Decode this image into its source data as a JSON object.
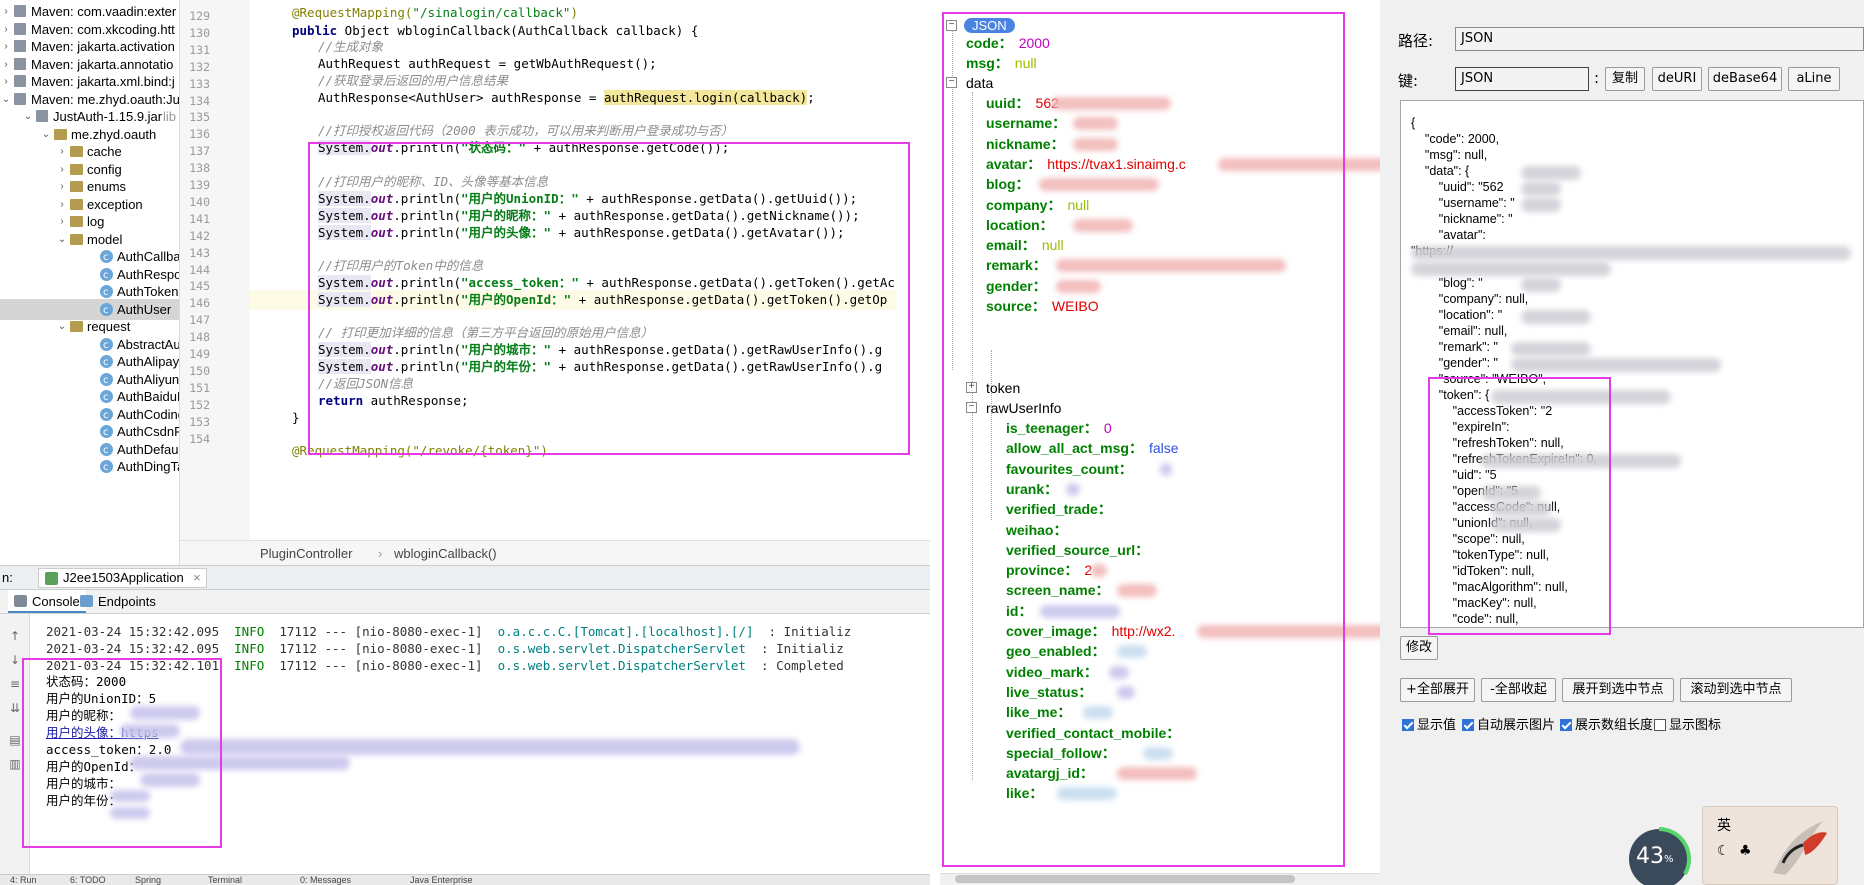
{
  "tree": {
    "rows": [
      {
        "label": "Maven: com.vaadin:exter",
        "type": "lib",
        "indent": 0
      },
      {
        "label": "Maven: com.xkcoding.htt",
        "type": "lib",
        "indent": 0
      },
      {
        "label": "Maven: jakarta.activation",
        "type": "lib",
        "indent": 0
      },
      {
        "label": "Maven: jakarta.annotatio",
        "type": "lib",
        "indent": 0
      },
      {
        "label": "Maven: jakarta.xml.bind:j",
        "type": "lib",
        "indent": 0
      },
      {
        "label": "Maven: me.zhyd.oauth:Ju",
        "type": "lib",
        "indent": 0
      },
      {
        "label": "JustAuth-1.15.9.jar",
        "suffix": "lib",
        "type": "lib",
        "indent": 1
      },
      {
        "label": "me.zhyd.oauth",
        "type": "pkg",
        "indent": 2
      },
      {
        "label": "cache",
        "type": "pkg",
        "indent": 3
      },
      {
        "label": "config",
        "type": "pkg",
        "indent": 3
      },
      {
        "label": "enums",
        "type": "pkg",
        "indent": 3
      },
      {
        "label": "exception",
        "type": "pkg",
        "indent": 3
      },
      {
        "label": "log",
        "type": "pkg",
        "indent": 3
      },
      {
        "label": "model",
        "type": "pkg",
        "indent": 3
      },
      {
        "label": "AuthCallba",
        "type": "cls",
        "indent": 4
      },
      {
        "label": "AuthRespo",
        "type": "cls",
        "indent": 4
      },
      {
        "label": "AuthToken",
        "type": "cls",
        "indent": 4
      },
      {
        "label": "AuthUser",
        "type": "cls",
        "indent": 4
      },
      {
        "label": "request",
        "type": "pkg",
        "indent": 3
      },
      {
        "label": "AbstractAu",
        "type": "cls",
        "indent": 4
      },
      {
        "label": "AuthAlipayl",
        "type": "cls",
        "indent": 4
      },
      {
        "label": "AuthAliyunl",
        "type": "cls",
        "indent": 4
      },
      {
        "label": "AuthBaiduF",
        "type": "cls",
        "indent": 4
      },
      {
        "label": "AuthCodingl",
        "type": "cls",
        "indent": 4
      },
      {
        "label": "AuthCsdnR",
        "type": "cls",
        "indent": 4
      },
      {
        "label": "AuthDefaul",
        "type": "cls",
        "indent": 4
      },
      {
        "label": "AuthDingTa",
        "type": "cls",
        "indent": 4
      }
    ]
  },
  "editor": {
    "line_numbers": [
      "129",
      "130",
      "131",
      "132",
      "133",
      "134",
      "135",
      "136",
      "137",
      "138",
      "139",
      "140",
      "141",
      "142",
      "143",
      "144",
      "145",
      "146",
      "147",
      "148",
      "149",
      "150",
      "151",
      "152",
      "153",
      "154"
    ],
    "annotation_top": "@RequestMapping(",
    "annotation_top_arg": "\"/sinalogin/callback\"",
    "annotation_top_end": ")",
    "sig_public": "public",
    "sig_rest": " Object wbloginCallback(AuthCallback callback) {",
    "c1": "//生成对象",
    "l1": "AuthRequest authRequest = getWbAuthRequest();",
    "c2": "//获取登录后返回的用户信息结果",
    "l2a": "AuthResponse<AuthUser> authResponse = ",
    "l2b": "authRequest.login(callback)",
    "l2c": ";",
    "c3a": "//打印授权返回代码（",
    "c3b": "2000",
    "c3c": " 表示成功，可以用来判断用户登录成功与否）",
    "p1s": "\"状态码：\"",
    "p1r": " + authResponse.getCode());",
    "c4a": "//打印用户的昵称、",
    "c4b": "ID",
    "c4c": "、头像等基本信息",
    "p2s": "\"用户的UnionID：\"",
    "p2r": " + authResponse.getData().getUuid());",
    "p3s": "\"用户的昵称：\"",
    "p3r": " + authResponse.getData().getNickname());",
    "p4s": "\"用户的头像：\"",
    "p4r": " + authResponse.getData().getAvatar());",
    "c5a": "//打印用户的",
    "c5b": "Token",
    "c5c": "中的信息",
    "p5s": "\"access_token：\"",
    "p5r": " + authResponse.getData().getToken().getAc",
    "p6s": "\"用户的OpenId：\"",
    "p6r": " + authResponse.getData().getToken().getOp",
    "c6": "// 打印更加详细的信息（第三方平台返回的原始用户信息）",
    "p7s": "\"用户的城市：\"",
    "p7r": " + authResponse.getData().getRawUserInfo().g",
    "p8s": "\"用户的年份：\"",
    "p8r": " + authResponse.getData().getRawUserInfo().g",
    "c7a": "//返回",
    "c7b": "JSON",
    "c7c": "信息",
    "ret_kw": "return",
    "ret_rest": " authResponse;",
    "close_brace": "}",
    "annotation_bottom": "@RequestMapping(\"/revoke/{token}\")",
    "sys": "System.",
    "out": "out",
    "println": ".println("
  },
  "breadcrumb": {
    "item1": "PluginController",
    "sep": "›",
    "item2": "wbloginCallback()"
  },
  "run_bar": {
    "prefix": "n:",
    "tab": "J2ee1503Application",
    "close": "×"
  },
  "console_tabs": {
    "console": "Console",
    "endpoints": "Endpoints"
  },
  "console": {
    "logs": [
      {
        "ts": "2021-03-24 15:32:42.095",
        "lvl": "INFO",
        "pid": "17112 --- [nio-8080-exec-1]",
        "cat": "o.a.c.c.C.[Tomcat].[localhost].[/]",
        "msg": ": Initializ"
      },
      {
        "ts": "2021-03-24 15:32:42.095",
        "lvl": "INFO",
        "pid": "17112 --- [nio-8080-exec-1]",
        "cat": "o.s.web.servlet.DispatcherServlet",
        "msg": ": Initializ"
      },
      {
        "ts": "2021-03-24 15:32:42.101",
        "lvl": "INFO",
        "pid": "17112 --- [nio-8080-exec-1]",
        "cat": "o.s.web.servlet.DispatcherServlet",
        "msg": ": Completed"
      }
    ],
    "out": [
      "状态码：2000",
      "用户的UnionID：5",
      "用户的昵称：",
      "用户的头像：https",
      "access_token：2.0",
      "用户的OpenId：",
      "用户的城市：",
      "用户的年份："
    ]
  },
  "status_bar": {
    "run": "4: Run",
    "todo": "6: TODO",
    "spring": "Spring",
    "terminal": "Terminal",
    "messages": "0: Messages",
    "java": "Java Enterprise"
  },
  "json_tree": {
    "root": "JSON",
    "code_key": "code：",
    "code_val": "2000",
    "msg_key": "msg：",
    "msg_val": "null",
    "data_key": "data",
    "data_fields": [
      {
        "key": "uuid：",
        "val": "562",
        "kind": "str"
      },
      {
        "key": "username：",
        "val": "",
        "kind": "str"
      },
      {
        "key": "nickname：",
        "val": "",
        "kind": "str"
      },
      {
        "key": "avatar：",
        "val": "https://tvax1.sinaimg.c",
        "kind": "str"
      },
      {
        "key": "blog：",
        "val": "",
        "kind": "str"
      },
      {
        "key": "company：",
        "val": "null",
        "kind": "null"
      },
      {
        "key": "location：",
        "val": "",
        "kind": "str"
      },
      {
        "key": "email：",
        "val": "null",
        "kind": "null"
      },
      {
        "key": "remark：",
        "val": "",
        "kind": "str"
      },
      {
        "key": "gender：",
        "val": "",
        "kind": "str"
      },
      {
        "key": "source：",
        "val": "WEIBO",
        "kind": "str"
      }
    ],
    "token_key": "token",
    "raw_key": "rawUserInfo",
    "raw_fields": [
      {
        "key": "is_teenager：",
        "val": "0",
        "kind": "num"
      },
      {
        "key": "allow_all_act_msg：",
        "val": "false",
        "kind": "bool"
      },
      {
        "key": "favourites_count：",
        "val": "",
        "kind": "num"
      },
      {
        "key": "urank：",
        "val": "",
        "kind": "num"
      },
      {
        "key": "verified_trade：",
        "val": "",
        "kind": "str"
      },
      {
        "key": "weihao：",
        "val": "",
        "kind": "str"
      },
      {
        "key": "verified_source_url：",
        "val": "",
        "kind": "str"
      },
      {
        "key": "province：",
        "val": "2",
        "kind": "str"
      },
      {
        "key": "screen_name：",
        "val": "",
        "kind": "str"
      },
      {
        "key": "id：",
        "val": "",
        "kind": "num"
      },
      {
        "key": "cover_image：",
        "val": "http://wx2.",
        "kind": "str"
      },
      {
        "key": "geo_enabled：",
        "val": "",
        "kind": "bool"
      },
      {
        "key": "video_mark：",
        "val": "",
        "kind": "num"
      },
      {
        "key": "live_status：",
        "val": "",
        "kind": "num"
      },
      {
        "key": "like_me：",
        "val": "",
        "kind": "bool"
      },
      {
        "key": "verified_contact_mobile：",
        "val": "",
        "kind": "str"
      },
      {
        "key": "special_follow：",
        "val": "",
        "kind": "bool"
      },
      {
        "key": "avatargj_id：",
        "val": "",
        "kind": "str"
      },
      {
        "key": "like：",
        "val": "",
        "kind": "bool"
      }
    ]
  },
  "panel": {
    "path_label": "路径:",
    "path_value": "JSON",
    "key_label": "键:",
    "key_value": "JSON",
    "colon": ":",
    "btn_copy": "复制",
    "btn_deuri": "deURI",
    "btn_debase64": "deBase64",
    "btn_aline": "aLine",
    "btn_modify": "修改",
    "btn_expand_all": "+全部展开",
    "btn_collapse_all": "-全部收起",
    "btn_expand_sel": "展开到选中节点",
    "btn_scroll_sel": "滚动到选中节点",
    "chk_show_value": "显示值",
    "chk_auto_img": "自动展示图片",
    "chk_array_len": "展示数组长度",
    "chk_show_icon": "显示图标",
    "text_lines": [
      "{",
      "    \"code\": 2000,",
      "    \"msg\": null,",
      "    \"data\": {",
      "        \"uuid\": \"562",
      "        \"username\": \"",
      "        \"nickname\": \"",
      "        \"avatar\":",
      "\"https://",
      "",
      "        \"blog\": \"",
      "        \"company\": null,",
      "        \"location\": \"",
      "        \"email\": null,",
      "        \"remark\": \"",
      "        \"gender\": \"",
      "        \"source\": \"WEIBO\",",
      "        \"token\": {",
      "            \"accessToken\": \"2",
      "            \"expireIn\":",
      "            \"refreshToken\": null,",
      "            \"refreshTokenExpireIn\": 0,",
      "            \"uid\": \"5",
      "            \"openId\": \"5",
      "            \"accessCode\": null,",
      "            \"unionId\": null,",
      "            \"scope\": null,",
      "            \"tokenType\": null,",
      "            \"idToken\": null,",
      "            \"macAlgorithm\": null,",
      "            \"macKey\": null,",
      "            \"code\": null,"
    ]
  },
  "widgets": {
    "percent": "43",
    "percent_sign": "%",
    "ime_lang": "英"
  },
  "colors": {
    "highlight_box": "#e53be6",
    "json_key": "#008000",
    "json_num": "#c000c0",
    "json_str": "#e00000",
    "json_null": "#98c000",
    "json_bool": "#3050e0"
  }
}
